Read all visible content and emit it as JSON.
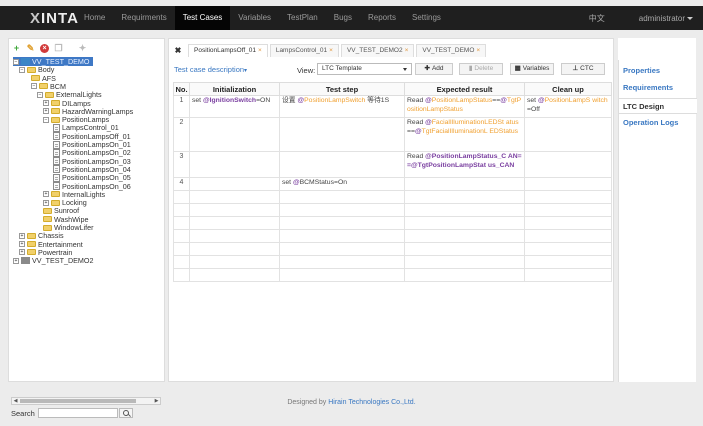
{
  "navbar": {
    "logo": "INTA",
    "logo_prefix": "X",
    "items": [
      {
        "label": "Home"
      },
      {
        "label": "Requirments"
      },
      {
        "label": "Test Cases",
        "active": true
      },
      {
        "label": "Variables"
      },
      {
        "label": "TestPlan"
      },
      {
        "label": "Bugs"
      },
      {
        "label": "Reports"
      },
      {
        "label": "Settings"
      }
    ],
    "language": "中文",
    "user": "administrator"
  },
  "tree": {
    "selected_node": "VV_TEST_DEMO",
    "nodes": [
      {
        "label": "VV_TEST_DEMO",
        "type": "project",
        "expander": "−",
        "selected": true
      },
      {
        "label": "Body",
        "type": "folder",
        "expander": "−"
      },
      {
        "label": "AFS",
        "type": "folder"
      },
      {
        "label": "BCM",
        "type": "folder",
        "expander": "−"
      },
      {
        "label": "ExternalLights",
        "type": "folder",
        "expander": "−"
      },
      {
        "label": "DILamps",
        "type": "folder",
        "expander": "+"
      },
      {
        "label": "HazardWarningLamps",
        "type": "folder",
        "expander": "+"
      },
      {
        "label": "PositionLamps",
        "type": "folder",
        "expander": "−"
      },
      {
        "label": "LampsControl_01",
        "type": "doc"
      },
      {
        "label": "PositionLampsOff_01",
        "type": "doc"
      },
      {
        "label": "PositionLampsOn_01",
        "type": "doc"
      },
      {
        "label": "PositionLampsOn_02",
        "type": "doc"
      },
      {
        "label": "PositionLampsOn_03",
        "type": "doc"
      },
      {
        "label": "PositionLampsOn_04",
        "type": "doc"
      },
      {
        "label": "PositionLampsOn_05",
        "type": "doc"
      },
      {
        "label": "PositionLampsOn_06",
        "type": "doc"
      },
      {
        "label": "InternalLights",
        "type": "folder",
        "expander": "+"
      },
      {
        "label": "Locking",
        "type": "folder",
        "expander": "+"
      },
      {
        "label": "Sunroof",
        "type": "folder"
      },
      {
        "label": "WashWipe",
        "type": "folder"
      },
      {
        "label": "WindowLifer",
        "type": "folder"
      },
      {
        "label": "Chassis",
        "type": "folder",
        "expander": "+"
      },
      {
        "label": "Entertainment",
        "type": "folder",
        "expander": "+"
      },
      {
        "label": "Powertrain",
        "type": "folder",
        "expander": "+"
      },
      {
        "label": "VV_TEST_DEMO2",
        "type": "project2",
        "expander": "+"
      }
    ],
    "search_label": "Search",
    "search_value": ""
  },
  "tabs": {
    "items": [
      {
        "label": "PositionLampsOff_01",
        "active": true
      },
      {
        "label": "LampsControl_01"
      },
      {
        "label": "VV_TEST_DEMO2"
      },
      {
        "label": "VV_TEST_DEMO"
      }
    ],
    "close_glyph": "×"
  },
  "toolbar": {
    "description_link": "Test case description",
    "view_label": "View:",
    "view_value": "LTC Template",
    "add": "Add",
    "delete": "Delete",
    "variables": "Variables",
    "ctc": "CTC"
  },
  "table": {
    "headers": [
      "No.",
      "Initialization",
      "Test step",
      "Expected result",
      "Clean up"
    ],
    "rows": [
      {
        "no": "1",
        "init": [
          {
            "t": "set "
          },
          {
            "t": "@",
            "c": "at"
          },
          {
            "t": "IgnitionSwitch",
            "c": "bold-var"
          },
          {
            "t": "=ON"
          }
        ],
        "step": [
          {
            "t": "设置 "
          },
          {
            "t": "@",
            "c": "at"
          },
          {
            "t": "PositionLampSwitch",
            "c": "var"
          },
          {
            "t": " 等待1S"
          }
        ],
        "expected": [
          {
            "t": "Read "
          },
          {
            "t": "@",
            "c": "at"
          },
          {
            "t": "PositionLampStatus",
            "c": "var"
          },
          {
            "t": "=="
          },
          {
            "t": "@",
            "c": "at"
          },
          {
            "t": "TgtPositionLampStatus",
            "c": "var"
          }
        ],
        "cleanup": [
          {
            "t": "set "
          },
          {
            "t": "@",
            "c": "at"
          },
          {
            "t": "PositionLampS witch",
            "c": "var"
          },
          {
            "t": "=Off"
          }
        ]
      },
      {
        "no": "2",
        "init": [],
        "step": [],
        "expected": [
          {
            "t": "Read "
          },
          {
            "t": "@",
            "c": "at"
          },
          {
            "t": "FacialIlluminationLEDSt atus",
            "c": "var"
          },
          {
            "t": "=="
          },
          {
            "t": "@",
            "c": "at"
          },
          {
            "t": "TgtFacialIlluminationL EDStatus",
            "c": "var"
          }
        ],
        "cleanup": []
      },
      {
        "no": "3",
        "init": [],
        "step": [],
        "expected": [
          {
            "t": "Read "
          },
          {
            "t": "@",
            "c": "at"
          },
          {
            "t": "PositionLampStatus_C AN==",
            "c": "bold-var"
          },
          {
            "t": "@",
            "c": "at"
          },
          {
            "t": "TgtPositionLampStat us_CAN",
            "c": "bold-var"
          }
        ],
        "cleanup": []
      },
      {
        "no": "4",
        "init": [],
        "step": [
          {
            "t": "set "
          },
          {
            "t": "@",
            "c": "at"
          },
          {
            "t": "BCMStatus=On"
          }
        ],
        "expected": [],
        "cleanup": []
      }
    ],
    "empty_rows": 7
  },
  "right_panel": {
    "items": [
      {
        "label": "Properties"
      },
      {
        "label": "Requirements"
      },
      {
        "label": "LTC Design",
        "active": true
      },
      {
        "label": "Operation Logs"
      }
    ]
  },
  "footer": {
    "prefix": "Designed by",
    "company": "Hirain Technologies Co.,Ltd."
  },
  "colors": {
    "navbar_bg": "#1f1f1f",
    "link_blue": "#3a78c2",
    "variable_orange": "#f0a030",
    "at_purple": "#7a3fa0",
    "tree_selected": "#3e78c5"
  }
}
